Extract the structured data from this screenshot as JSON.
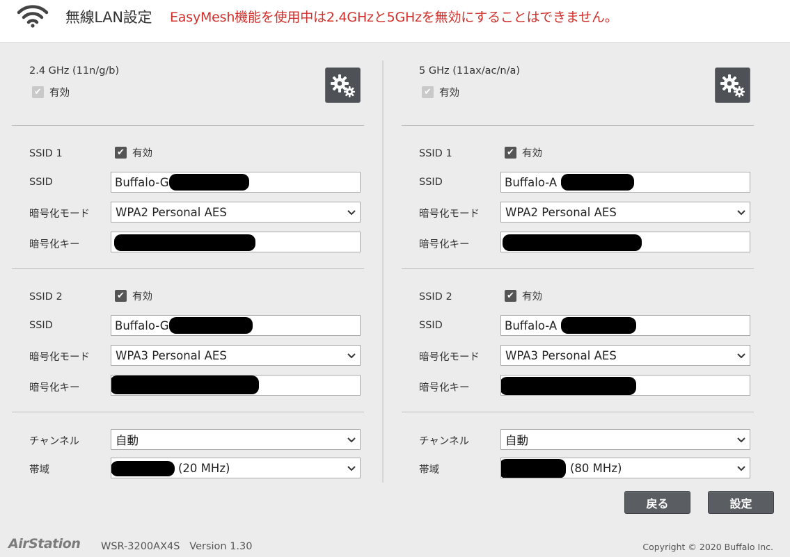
{
  "header": {
    "title": "無線LAN設定",
    "warning": "EasyMesh機能を使用中は2.4GHzと5GHzを無効にすることはできません。"
  },
  "left": {
    "band": "2.4 GHz (11n/g/b)",
    "band_enable_label": "有効",
    "ssid1": {
      "heading": "SSID 1",
      "enable_label": "有効",
      "ssid_label": "SSID",
      "ssid_value": "Buffalo-G",
      "mode_label": "暗号化モード",
      "mode_value": "WPA2 Personal AES",
      "key_label": "暗号化キー"
    },
    "ssid2": {
      "heading": "SSID 2",
      "enable_label": "有効",
      "ssid_label": "SSID",
      "ssid_value": "Buffalo-G",
      "mode_label": "暗号化モード",
      "mode_value": "WPA3 Personal AES",
      "key_label": "暗号化キー"
    },
    "channel_label": "チャンネル",
    "channel_value": "自動",
    "bandwidth_label": "帯域",
    "bandwidth_value": "(20 MHz)"
  },
  "right": {
    "band": "5 GHz (11ax/ac/n/a)",
    "band_enable_label": "有効",
    "ssid1": {
      "heading": "SSID 1",
      "enable_label": "有効",
      "ssid_label": "SSID",
      "ssid_value": "Buffalo-A",
      "mode_label": "暗号化モード",
      "mode_value": "WPA2 Personal AES",
      "key_label": "暗号化キー"
    },
    "ssid2": {
      "heading": "SSID 2",
      "enable_label": "有効",
      "ssid_label": "SSID",
      "ssid_value": "Buffalo-A",
      "mode_label": "暗号化モード",
      "mode_value": "WPA3 Personal AES",
      "key_label": "暗号化キー"
    },
    "channel_label": "チャンネル",
    "channel_value": "自動",
    "bandwidth_label": "帯域",
    "bandwidth_value": "(80 MHz)"
  },
  "buttons": {
    "back": "戻る",
    "save": "設定"
  },
  "footer": {
    "logo": "AirStation",
    "model": "WSR-3200AX4S   Version 1.30",
    "copyright": "Copyright © 2020 Buffalo Inc."
  },
  "icons": {
    "wifi": "wifi-icon",
    "settings": "gears-icon",
    "dropdown": "chevron-down-icon"
  },
  "colors": {
    "warning": "#d0302c",
    "button": "#5a5e63"
  }
}
